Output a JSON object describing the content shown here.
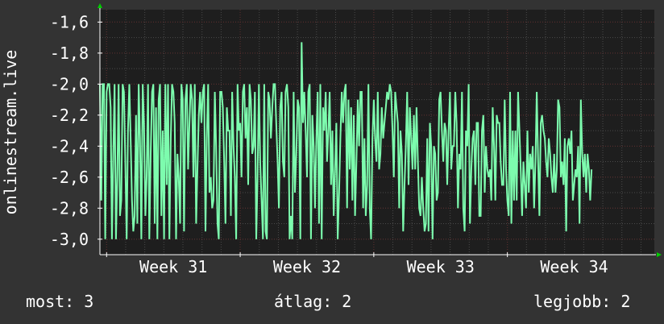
{
  "colors": {
    "background": "#333333",
    "plot_background": "#1e1e1e",
    "grid_major": "#5a2a2a",
    "grid_minor": "#4a4a4a",
    "line": "#7dfcae",
    "axis": "#ffffff",
    "arrow": "#00cc00"
  },
  "stats": {
    "current": "most: 3",
    "average": "átlag: 2",
    "best": "legjobb: 2"
  },
  "chart_data": {
    "type": "line",
    "ylabel": "onlinestream.live",
    "ylim": [
      -3.1,
      -1.52
    ],
    "yticks": [
      -1.6,
      -1.8,
      -2.0,
      -2.2,
      -2.4,
      -2.6,
      -2.8,
      -3.0
    ],
    "ytick_labels": [
      "-1,6",
      "-1,8",
      "-2,0",
      "-2,2",
      "-2,4",
      "-2,6",
      "-2,8",
      "-3,0"
    ],
    "xlim": [
      30.45,
      34.6
    ],
    "xticks": [
      31,
      32,
      33,
      34
    ],
    "xtick_labels": [
      "Week 31",
      "Week 32",
      "Week 33",
      "Week 34"
    ],
    "grid": true,
    "series": [
      {
        "x_start": 30.45,
        "x_step": 0.01,
        "y": [
          -2,
          -2.75,
          -2,
          -2,
          -3,
          -2.05,
          -2,
          -2,
          -2.15,
          -3,
          -2.45,
          -2,
          -3,
          -2.6,
          -2,
          -2.85,
          -2.75,
          -2,
          -2.05,
          -2.5,
          -3,
          -2.3,
          -2,
          -2.35,
          -2.75,
          -2.95,
          -2.85,
          -2.2,
          -2.9,
          -2,
          -2.35,
          -3,
          -2,
          -2.25,
          -2.85,
          -2.6,
          -2,
          -3,
          -2.45,
          -2.05,
          -2,
          -2.9,
          -2.15,
          -3,
          -2.1,
          -2,
          -2.85,
          -2.3,
          -3,
          -2,
          -2.65,
          -2,
          -3,
          -2.35,
          -2,
          -2.05,
          -2.25,
          -3,
          -2.45,
          -2.6,
          -2.9,
          -2,
          -2.1,
          -2.95,
          -2.1,
          -2,
          -2.55,
          -2.25,
          -2,
          -2.1,
          -2.6,
          -2,
          -2.9,
          -2.55,
          -2.2,
          -2.05,
          -2.25,
          -2.05,
          -2,
          -2.95,
          -2.35,
          -2,
          -2.7,
          -2.6,
          -2.8,
          -2.75,
          -2.05,
          -2.4,
          -2.9,
          -3,
          -2.05,
          -2.05,
          -2.15,
          -2.5,
          -2.9,
          -2.15,
          -2.3,
          -2.3,
          -2.85,
          -2.05,
          -2.4,
          -2.6,
          -3,
          -2,
          -2.3,
          -2.25,
          -2.6,
          -2.05,
          -2,
          -2.35,
          -2.15,
          -2.65,
          -2,
          -2.1,
          -2.45,
          -2.4,
          -2.05,
          -3,
          -2.6,
          -2,
          -2.5,
          -2.75,
          -3,
          -2,
          -2.95,
          -3,
          -2.05,
          -2.1,
          -2.35,
          -2.15,
          -2,
          -2,
          -2.25,
          -2.5,
          -2.8,
          -2.15,
          -2.05,
          -2.5,
          -2.6,
          -2.05,
          -2,
          -2.15,
          -3,
          -2.85,
          -3,
          -2.05,
          -2.7,
          -2.45,
          -2.1,
          -2.15,
          -3,
          -1.73,
          -2.25,
          -2.05,
          -2.3,
          -2.6,
          -2.05,
          -2,
          -3,
          -2.2,
          -2.4,
          -2.8,
          -2.35,
          -2.05,
          -2.9,
          -2,
          -3,
          -2.15,
          -2.3,
          -2.05,
          -2.5,
          -2.3,
          -2.05,
          -2.65,
          -2.3,
          -2.85,
          -2.55,
          -2.25,
          -3,
          -2.7,
          -2.35,
          -2.05,
          -2.25,
          -2.05,
          -2,
          -2.8,
          -2.1,
          -2.55,
          -2.15,
          -2.75,
          -2.2,
          -2.85,
          -2.5,
          -2.1,
          -2.4,
          -2.05,
          -2.05,
          -2.8,
          -2.35,
          -2.85,
          -2.65,
          -2,
          -2.8,
          -3,
          -2.35,
          -2.1,
          -2.35,
          -2.5,
          -2.05,
          -2.55,
          -2.45,
          -2.15,
          -2.35,
          -2.25,
          -2.15,
          -2.05,
          -2.1,
          -2,
          -2.05,
          -2.3,
          -2.6,
          -2.05,
          -2.15,
          -2.25,
          -2.8,
          -2.3,
          -2.45,
          -2.95,
          -2.65,
          -2.4,
          -2.05,
          -2.65,
          -2.15,
          -2.35,
          -2.55,
          -2.2,
          -2.55,
          -2.15,
          -2.5,
          -2.8,
          -2.85,
          -2.6,
          -2.8,
          -2.95,
          -2.9,
          -2.35,
          -2.95,
          -2.25,
          -2.4,
          -3,
          -2.4,
          -2.45,
          -2.75,
          -2.7,
          -2.1,
          -2.05,
          -2.3,
          -2.5,
          -2.25,
          -2.3,
          -2.65,
          -2.3,
          -2.05,
          -2.55,
          -2.4,
          -2.4,
          -2.05,
          -2.25,
          -2.8,
          -2.45,
          -2.55,
          -2.05,
          -2.8,
          -2.95,
          -2.3,
          -2.4,
          -2,
          -2.9,
          -2.55,
          -2.35,
          -2.3,
          -2.65,
          -2.25,
          -2.25,
          -2.85,
          -2.85,
          -2.3,
          -2.2,
          -2.7,
          -2.4,
          -2.55,
          -2.6,
          -2.55,
          -2.75,
          -2.15,
          -2.4,
          -2.75,
          -2.2,
          -2.25,
          -2.25,
          -2.5,
          -2.65,
          -2.65,
          -2.1,
          -2.55,
          -2.75,
          -2.85,
          -2.05,
          -2.9,
          -2.3,
          -2.75,
          -2.3,
          -2.75,
          -2.05,
          -2.3,
          -2.55,
          -2.85,
          -2.5,
          -2.65,
          -2.8,
          -2.3,
          -2.7,
          -2.45,
          -2.55,
          -2.4,
          -2.8,
          -2.5,
          -2.05,
          -2.5,
          -2.85,
          -2.25,
          -2.2,
          -2.3,
          -2.35,
          -2.5,
          -2.6,
          -2.35,
          -2.45,
          -2.6,
          -2.7,
          -2.45,
          -2.7,
          -2.55,
          -2.1,
          -2.15,
          -2.6,
          -2.5,
          -2.65,
          -2.35,
          -2.95,
          -2.4,
          -2.35,
          -2.45,
          -2.3,
          -2.75,
          -2.65,
          -2.55,
          -2.6,
          -2.4,
          -2.9,
          -2.1,
          -2.45,
          -2.6,
          -2.45,
          -2.7,
          -2.45,
          -2.55,
          -2.75,
          -2.55
        ]
      }
    ]
  }
}
